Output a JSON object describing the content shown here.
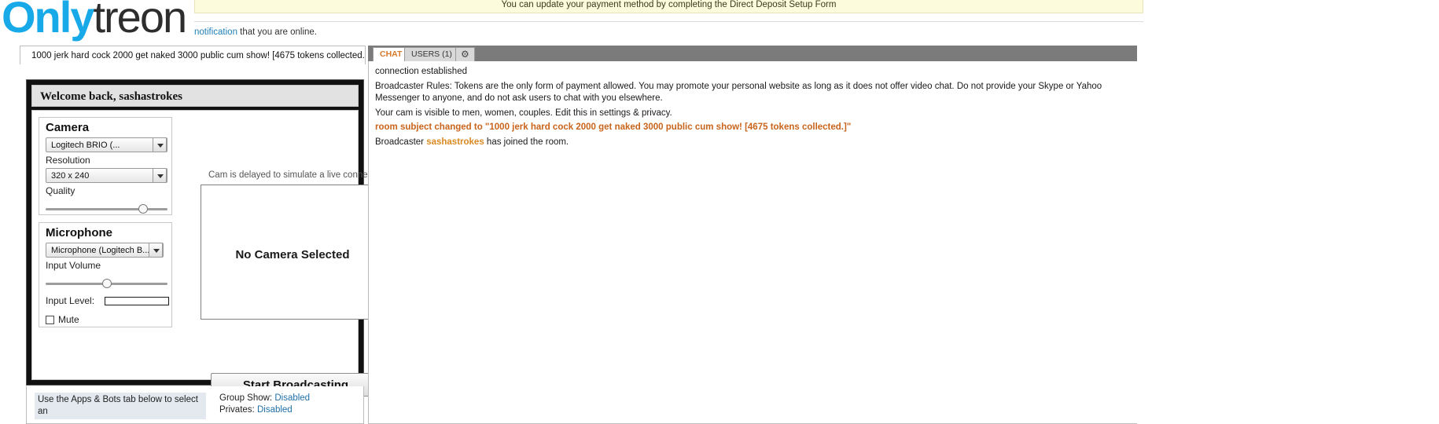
{
  "brand": {
    "part1": "Only",
    "part2": "treon"
  },
  "banner": {
    "message": "You can update your payment method by completing the Direct Deposit Setup Form"
  },
  "online_notice": {
    "link_text": "notification",
    "rest": " that you are online."
  },
  "room": {
    "subject": "1000 jerk hard cock 2000 get naked 3000 public cum show! [4675 tokens collected.]"
  },
  "broadcaster": {
    "welcome": "Welcome back, sashastrokes",
    "camera": {
      "title": "Camera",
      "device": "Logitech BRIO (...",
      "resolution_label": "Resolution",
      "resolution": "320 x 240",
      "quality_label": "Quality"
    },
    "microphone": {
      "title": "Microphone",
      "device": "Microphone (Logitech B...",
      "input_volume_label": "Input Volume",
      "input_level_label": "Input Level:",
      "mute_label": "Mute"
    },
    "preview": {
      "delay_note": "Cam is delayed to simulate a live connection",
      "placeholder": "No Camera Selected"
    },
    "broadcast_button": "Start Broadcasting"
  },
  "bottom": {
    "apps_note": "Use the Apps & Bots tab below to select an",
    "group_show_label": "Group Show:",
    "group_show_value": "Disabled",
    "privates_label": "Privates:",
    "privates_value": "Disabled"
  },
  "chat": {
    "tabs": [
      {
        "label": "CHAT",
        "active": true
      },
      {
        "label": "USERS (1)",
        "active": false
      }
    ],
    "gear_icon": "gear-icon",
    "messages": [
      {
        "type": "system",
        "text": "connection established"
      },
      {
        "type": "system",
        "text": "Broadcaster Rules: Tokens are the only form of payment allowed. You may promote your personal website as long as it does not offer video chat. Do not provide your Skype or Yahoo Messenger to anyone, and do not ask users to chat with you elsewhere."
      },
      {
        "type": "system",
        "text": "Your cam is visible to men, women, couples. Edit this in settings & privacy."
      },
      {
        "type": "subject",
        "text": "room subject changed to \"1000 jerk hard cock 2000 get naked 3000 public cum show! [4675 tokens collected.]\""
      },
      {
        "type": "join",
        "prefix": "Broadcaster ",
        "user": "sashastrokes",
        "suffix": " has joined the room."
      }
    ]
  },
  "colors": {
    "brand_blue": "#17a9e8",
    "banner_bg": "#fcfbdc",
    "subject_orange": "#c8641b",
    "tab_active_text": "#d9792b"
  }
}
